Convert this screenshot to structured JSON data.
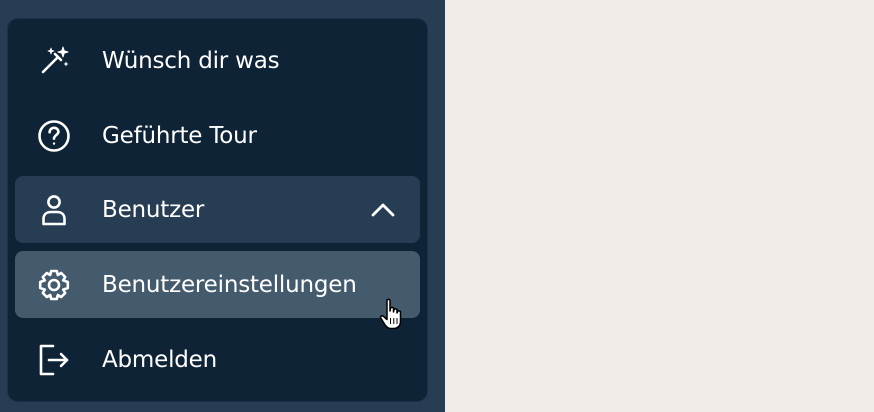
{
  "menu": {
    "items": [
      {
        "label": "Wünsch dir was",
        "icon": "magic-wand-icon"
      },
      {
        "label": "Geführte Tour",
        "icon": "question-circle-icon"
      },
      {
        "label": "Benutzer",
        "icon": "user-icon",
        "state": "expanded",
        "chevron": "chevron-up-icon"
      },
      {
        "label": "Benutzereinstellungen",
        "icon": "gear-icon",
        "state": "hovered"
      },
      {
        "label": "Abmelden",
        "icon": "logout-icon"
      }
    ]
  },
  "colors": {
    "page_background": "#f1ece8",
    "sidebar_background": "#273d53",
    "menu_background": "#0f2336",
    "expanded_item_background": "#273d53",
    "hovered_item_background": "#445a6d",
    "text": "#ffffff"
  }
}
